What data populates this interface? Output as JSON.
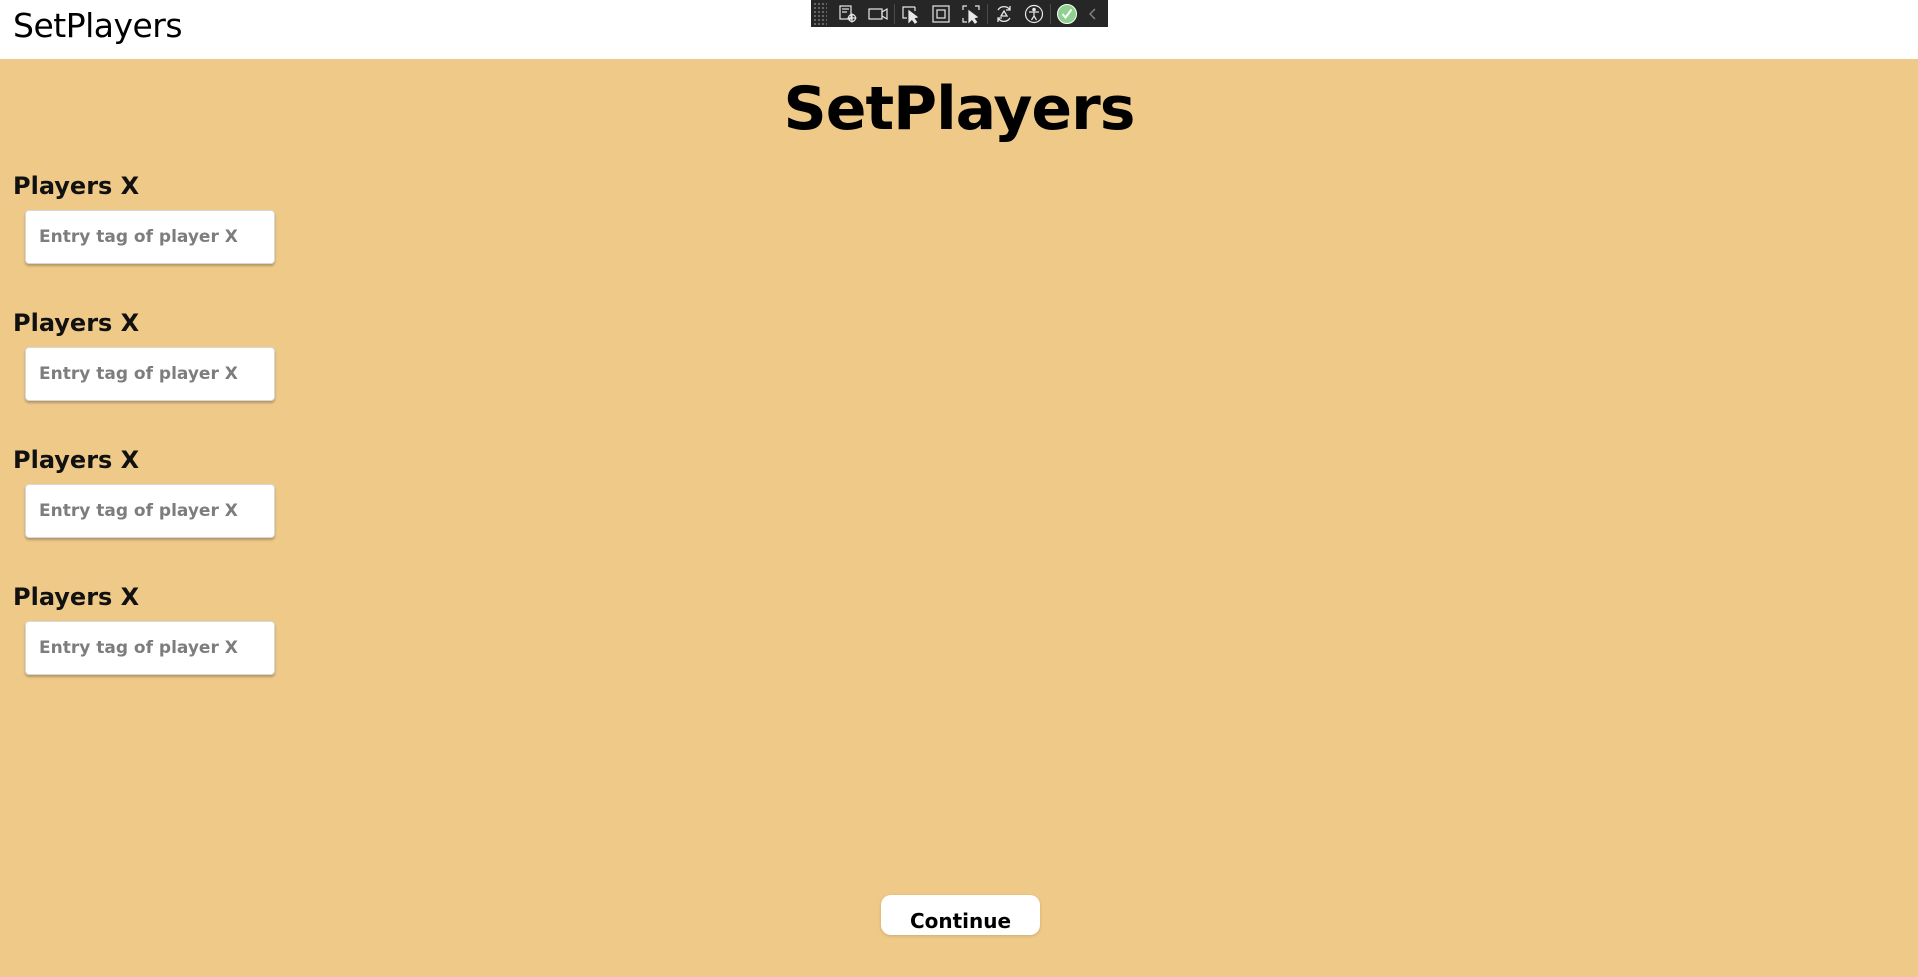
{
  "window": {
    "title": "SetPlayers"
  },
  "debug_toolbar": {
    "icons": [
      "live-visual-tree-icon",
      "video-camera-icon",
      "select-element-icon",
      "display-layout-adorners-icon",
      "track-focused-element-icon",
      "hot-reload-icon",
      "accessibility-checker-icon",
      "check-ok-icon",
      "collapse-chevron-icon"
    ]
  },
  "page": {
    "heading": "SetPlayers",
    "players": [
      {
        "label": "Players X",
        "placeholder": "Entry tag of player X",
        "value": ""
      },
      {
        "label": "Players X",
        "placeholder": "Entry tag of player X",
        "value": ""
      },
      {
        "label": "Players X",
        "placeholder": "Entry tag of player X",
        "value": ""
      },
      {
        "label": "Players X",
        "placeholder": "Entry tag of player X",
        "value": ""
      }
    ],
    "bottom_button_label": "Continue"
  },
  "colors": {
    "background": "#efc987",
    "titlebar": "#ffffff",
    "toolbar": "#262626",
    "check_badge": "#8fd18f"
  }
}
